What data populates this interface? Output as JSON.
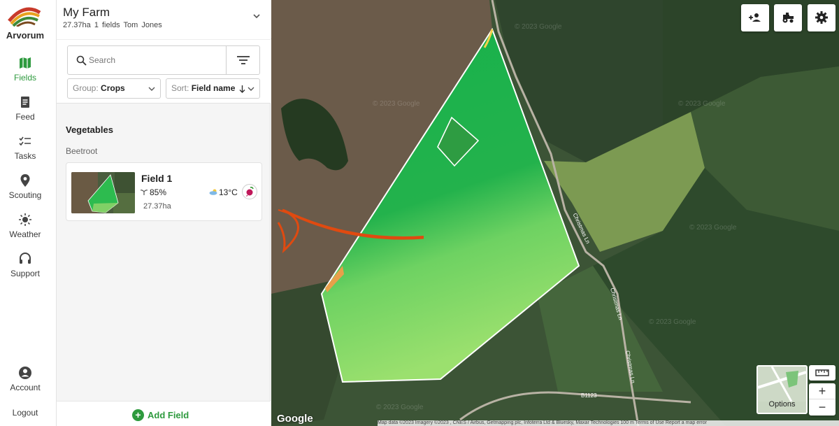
{
  "app": {
    "brand": "Arvorum"
  },
  "nav": {
    "items": [
      {
        "label": "Fields",
        "icon": "map-icon",
        "active": true
      },
      {
        "label": "Feed",
        "icon": "document-icon"
      },
      {
        "label": "Tasks",
        "icon": "checklist-icon"
      },
      {
        "label": "Scouting",
        "icon": "location-pin-icon"
      },
      {
        "label": "Weather",
        "icon": "sun-icon"
      },
      {
        "label": "Support",
        "icon": "headset-icon"
      }
    ],
    "account": "Account",
    "logout": "Logout"
  },
  "farm": {
    "name": "My Farm",
    "area": "27.37ha",
    "field_count": "1 fields",
    "owner": "Tom Jones"
  },
  "search": {
    "placeholder": "Search"
  },
  "group": {
    "label": "Group:",
    "value": "Crops"
  },
  "sort": {
    "label": "Sort:",
    "value": "Field name"
  },
  "list": {
    "group_heading": "Vegetables",
    "crop_heading": "Beetroot",
    "fields": [
      {
        "name": "Field 1",
        "health": "85%",
        "area": "27.37ha",
        "temperature": "13°C",
        "crop_icon": "beetroot-icon"
      }
    ]
  },
  "add_field": {
    "label": "Add Field"
  },
  "map": {
    "options_label": "Options",
    "zoom_in": "+",
    "zoom_out": "−",
    "google": "Google",
    "attribution": "Map data ©2023 Imagery ©2023 , CNES / Airbus, Getmapping plc, Infoterra Ltd & Bluesky, Maxar Technologies   100 m   Terms of Use   Report a map error",
    "watermark": "© 2023 Google",
    "roads": [
      "Christmas Ln",
      "Christmas Ln",
      "Christmas Ln",
      "B1123"
    ]
  },
  "colors": {
    "accent": "#2e9a3e",
    "field_fill": "#1fa84a",
    "annotation_arrow": "#e04a10"
  }
}
